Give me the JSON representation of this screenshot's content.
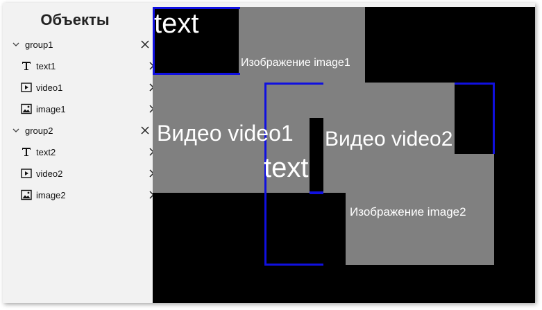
{
  "sidebar": {
    "title": "Объекты",
    "items": [
      {
        "type": "group",
        "label": "group1",
        "icon": "chevron-down-icon"
      },
      {
        "type": "child",
        "label": "text1",
        "icon": "text-icon"
      },
      {
        "type": "child",
        "label": "video1",
        "icon": "video-icon"
      },
      {
        "type": "child",
        "label": "image1",
        "icon": "image-icon"
      },
      {
        "type": "group",
        "label": "group2",
        "icon": "chevron-down-icon"
      },
      {
        "type": "child",
        "label": "text2",
        "icon": "text-icon"
      },
      {
        "type": "child",
        "label": "video2",
        "icon": "video-icon"
      },
      {
        "type": "child",
        "label": "image2",
        "icon": "image-icon"
      }
    ],
    "remove_icon": "close-icon"
  },
  "canvas": {
    "background": "#000000",
    "element_fill": "#808080",
    "selection_color": "#1010e0",
    "labels": {
      "text1": "text",
      "image1": "Изображение image1",
      "video1": "Видео video1",
      "video2": "Видео video2",
      "text2": "text",
      "image2": "Изображение image2"
    }
  }
}
